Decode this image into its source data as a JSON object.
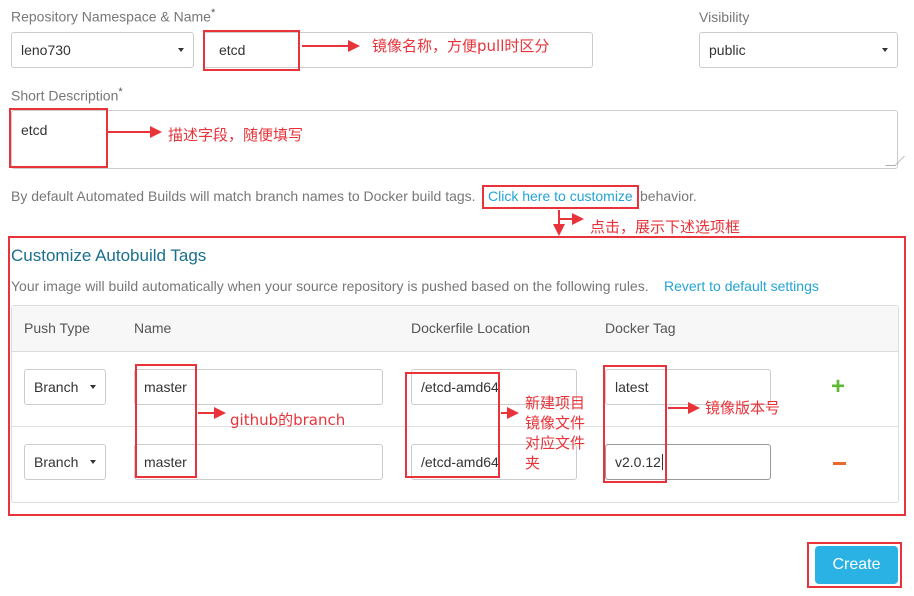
{
  "repo": {
    "label": "Repository Namespace & Name",
    "required_mark": "*",
    "namespace": "leno730",
    "name": "etcd"
  },
  "visibility": {
    "label": "Visibility",
    "value": "public"
  },
  "description": {
    "label": "Short Description",
    "required_mark": "*",
    "value": "etcd"
  },
  "default_builds": {
    "text_before": "By default Automated Builds will match branch names to Docker build tags.",
    "link": "Click here to customize",
    "text_after": "behavior."
  },
  "autobuild": {
    "title": "Customize Autobuild Tags",
    "desc": "Your image will build automatically when your source repository is pushed based on the following rules.",
    "revert_link": "Revert to default settings",
    "headers": {
      "push_type": "Push Type",
      "name": "Name",
      "location": "Dockerfile Location",
      "tag": "Docker Tag"
    },
    "rows": [
      {
        "push_type": "Branch",
        "name": "master",
        "location": "/etcd-amd64",
        "tag": "latest",
        "action": "+"
      },
      {
        "push_type": "Branch",
        "name": "master",
        "location": "/etcd-amd64",
        "tag": "v2.0.12",
        "action": "minus"
      }
    ]
  },
  "create_button": "Create",
  "annotations": {
    "repo_name": "镜像名称，方便pull时区分",
    "description": "描述字段，随便填写",
    "click": "点击，展示下述选项框",
    "branch": "github的branch",
    "location_lines": [
      "新建项目",
      "镜像文件",
      "对应文件",
      "夹"
    ],
    "tag": "镜像版本号"
  },
  "colors": {
    "annotation": "#e8333a",
    "link": "#23a4d6",
    "create": "#2ab2e4",
    "plus": "#5fb838",
    "minus": "#e86a2a"
  }
}
